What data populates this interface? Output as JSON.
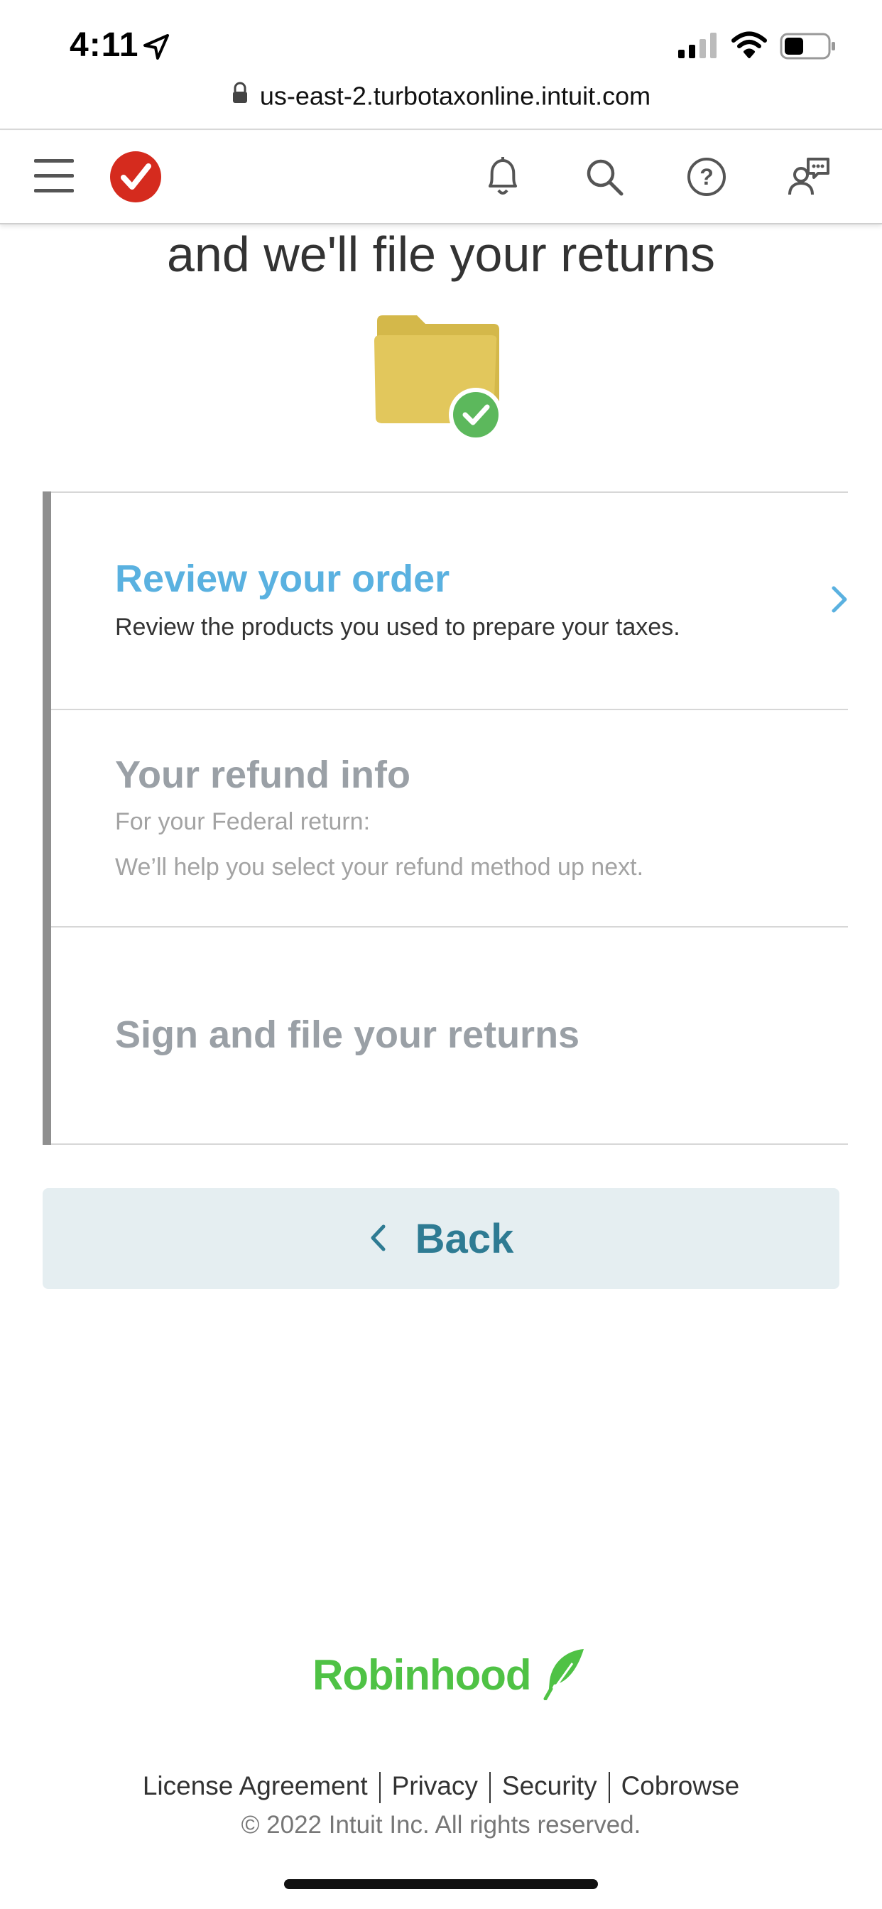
{
  "status_bar": {
    "time": "4:11",
    "icons": [
      "location-arrow-icon",
      "cellular-signal-icon",
      "wifi-icon",
      "battery-icon"
    ]
  },
  "browser": {
    "url": "us-east-2.turbotaxonline.intuit.com"
  },
  "nav": {
    "icons": [
      "hamburger-menu-icon",
      "turbotax-logo-icon",
      "bell-icon",
      "search-icon",
      "help-icon",
      "chat-icon"
    ],
    "brand_color": "#d52b1e"
  },
  "page": {
    "heading": "and we'll file your returns"
  },
  "steps": [
    {
      "title": "Review your order",
      "description": "Review the products you used to prepare your taxes.",
      "state": "active"
    },
    {
      "title": "Your refund info",
      "description_line1": "For your Federal return:",
      "description_line2": "We’ll help you select your refund method up next.",
      "state": "disabled"
    },
    {
      "title": "Sign and file your returns",
      "state": "disabled"
    }
  ],
  "back_button": {
    "label": "Back"
  },
  "partner": {
    "name": "Robinhood",
    "color": "#4fc245"
  },
  "footer": {
    "links": [
      "License Agreement",
      "Privacy",
      "Security",
      "Cobrowse"
    ],
    "copyright": "© 2022 Intuit Inc. All rights reserved."
  }
}
